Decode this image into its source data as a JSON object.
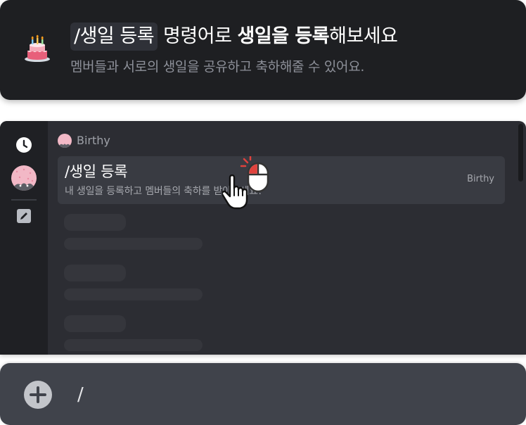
{
  "banner": {
    "cake_icon": "birthday-cake-icon",
    "command_chip": "/생일 등록",
    "text_mid": "명령어로",
    "text_bold": "생일을 등록",
    "text_end": "해보세요",
    "subtitle": "멤버들과 서로의 생일을 공유하고 축하해줄 수 있어요."
  },
  "sidebar": {
    "icons": [
      "clock-icon",
      "bot-avatar",
      "edit-icon"
    ]
  },
  "bot": {
    "name": "Birthy"
  },
  "command": {
    "title": "/생일 등록",
    "description": "내 생일을 등록하고 멤버들의 축하를 받아보세요!",
    "source": "Birthy"
  },
  "input": {
    "value": "/",
    "plus_icon": "plus-icon"
  },
  "colors": {
    "banner_bg": "#1e1f22",
    "panel_bg": "#2c2d33",
    "sidebar_bg": "#1f2024",
    "highlight_row": "#393b42",
    "input_bg": "#40434b",
    "click_accent": "#e0423d"
  }
}
